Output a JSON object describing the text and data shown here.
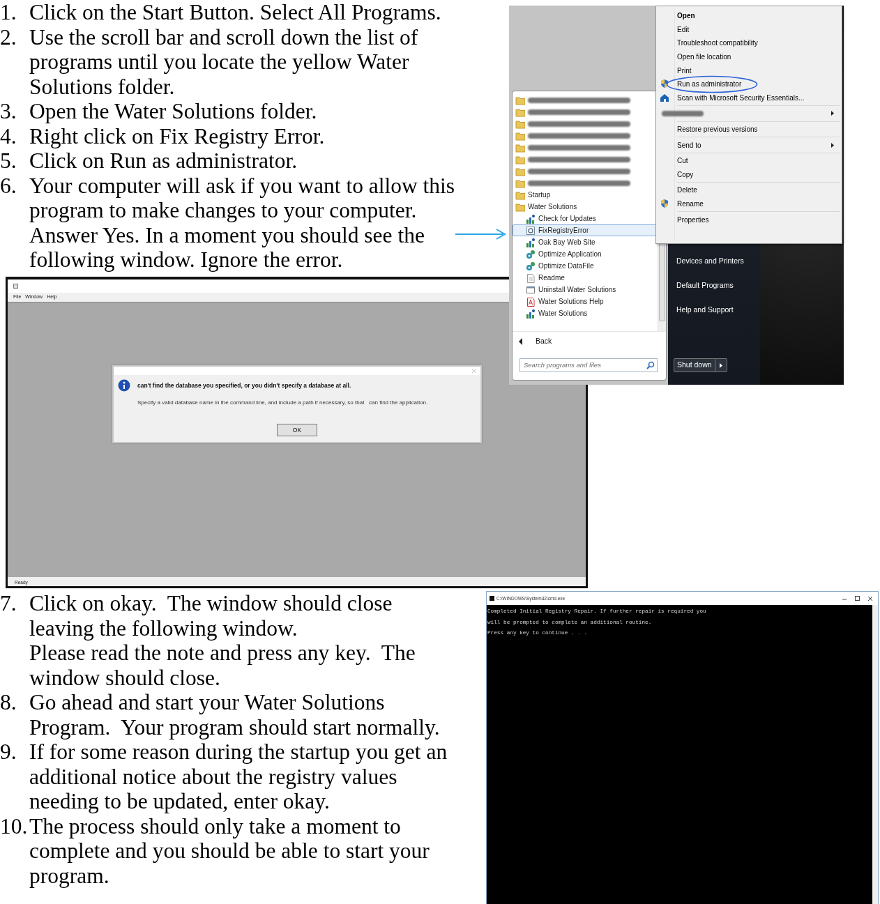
{
  "instructions_top": [
    {
      "number": "1.",
      "paragraphs": [
        "Click on the Start Button. Select All Programs."
      ]
    },
    {
      "number": "2.",
      "paragraphs": [
        "Use the scroll bar and scroll down the list of programs until you locate the yellow Water Solutions folder."
      ]
    },
    {
      "number": "3.",
      "paragraphs": [
        "Open the Water Solutions folder."
      ]
    },
    {
      "number": "4.",
      "paragraphs": [
        "Right click on Fix Registry Error."
      ]
    },
    {
      "number": "5.",
      "paragraphs": [
        "Click on Run as administrator."
      ]
    },
    {
      "number": "6.",
      "paragraphs": [
        "Your computer will ask if you want to allow this program to make changes to your computer. Answer Yes. In a moment you should see the following window. Ignore the error."
      ]
    }
  ],
  "start_menu": {
    "programs": [
      {
        "kind": "redacted-folder",
        "selected": false
      },
      {
        "kind": "redacted-folder",
        "selected": false
      },
      {
        "kind": "redacted-folder",
        "selected": false
      },
      {
        "kind": "redacted-folder",
        "selected": false
      },
      {
        "kind": "redacted-folder",
        "selected": false
      },
      {
        "kind": "redacted-folder",
        "selected": false
      },
      {
        "kind": "redacted-folder",
        "selected": false
      },
      {
        "kind": "redacted-folder",
        "selected": false
      },
      {
        "kind": "folder",
        "label": "Startup",
        "selected": false
      },
      {
        "kind": "folder",
        "label": "Water Solutions",
        "selected": false,
        "children": [
          {
            "kind": "chart",
            "label": "Check for Updates",
            "selected": false
          },
          {
            "kind": "gear-document",
            "label": "FixRegistryError",
            "selected": true
          },
          {
            "kind": "chart",
            "label": "Oak Bay Web Site",
            "selected": false
          },
          {
            "kind": "gears",
            "label": "Optimize Application",
            "selected": false
          },
          {
            "kind": "gears",
            "label": "Optimize DataFile",
            "selected": false
          },
          {
            "kind": "document",
            "label": "Readme",
            "selected": false
          },
          {
            "kind": "window",
            "label": "Uninstall Water Solutions",
            "selected": false
          },
          {
            "kind": "pdf",
            "label": "Water Solutions Help",
            "selected": false
          },
          {
            "kind": "chart",
            "label": "Water Solutions",
            "selected": false
          }
        ]
      }
    ],
    "back": "Back",
    "search": {
      "placeholder": "Search programs and files"
    },
    "right_links": [
      "Devices and Printers",
      "Default Programs",
      "Help and Support"
    ],
    "shutdown": "Shut down"
  },
  "context_menu": {
    "groups": [
      [
        {
          "kind": "plain",
          "label": "Open",
          "bold": true,
          "submenu": false,
          "circled": false
        },
        {
          "kind": "plain",
          "label": "Edit",
          "bold": false,
          "submenu": false,
          "circled": false
        },
        {
          "kind": "plain",
          "label": "Troubleshoot compatibility",
          "bold": false,
          "submenu": false,
          "circled": false
        },
        {
          "kind": "plain",
          "label": "Open file location",
          "bold": false,
          "submenu": false,
          "circled": false
        },
        {
          "kind": "plain",
          "label": "Print",
          "bold": false,
          "submenu": false,
          "circled": false
        },
        {
          "kind": "shield",
          "label": "Run as administrator",
          "bold": false,
          "submenu": false,
          "circled": true
        },
        {
          "kind": "scanner",
          "label": "Scan with Microsoft Security Essentials...",
          "bold": false,
          "submenu": false,
          "circled": false
        }
      ],
      [
        {
          "kind": "redacted",
          "submenu": true
        }
      ],
      [
        {
          "kind": "plain",
          "label": "Restore previous versions",
          "bold": false,
          "submenu": false,
          "circled": false
        }
      ],
      [
        {
          "kind": "plain",
          "label": "Send to",
          "bold": false,
          "submenu": true,
          "circled": false
        }
      ],
      [
        {
          "kind": "plain",
          "label": "Cut",
          "bold": false,
          "submenu": false,
          "circled": false
        },
        {
          "kind": "plain",
          "label": "Copy",
          "bold": false,
          "submenu": false,
          "circled": false
        }
      ],
      [
        {
          "kind": "plain",
          "label": "Delete",
          "bold": false,
          "submenu": false,
          "circled": false
        },
        {
          "kind": "shield",
          "label": "Rename",
          "bold": false,
          "submenu": false,
          "circled": false
        }
      ],
      [
        {
          "kind": "plain",
          "label": "Properties",
          "bold": false,
          "submenu": false,
          "circled": false
        }
      ]
    ]
  },
  "app_window": {
    "menu": [
      "File",
      "Window",
      "Help"
    ],
    "dialog": {
      "heading": "can't find the database you specified, or you didn't specify a database at all.",
      "message": "Specify a valid database name in the command line, and include a path if necessary, so that   can find the application.",
      "button": "OK"
    },
    "status": "Ready"
  },
  "instructions_bottom": [
    {
      "number": "7.",
      "paragraphs": [
        "Click on okay.  The window should close leaving the following window.",
        "Please read the note and press any key.  The window should close."
      ]
    },
    {
      "number": "8.",
      "paragraphs": [
        "Go ahead and start your Water Solutions Program.  Your program should start normally."
      ]
    },
    {
      "number": "9.",
      "paragraphs": [
        "If for some reason during the startup you get an additional notice about the registry values needing to be updated, enter okay."
      ]
    },
    {
      "number": "10.",
      "paragraphs": [
        "The process should only take a moment to complete and you should be able to start your program."
      ]
    }
  ],
  "cmd_window": {
    "title": "C:\\WINDOWS\\System32\\cmd.exe",
    "lines": [
      "Completed Initial Registry Repair. If further repair is required you",
      "will be prompted to complete an additional routine.",
      "Press any key to continue . . ."
    ]
  }
}
